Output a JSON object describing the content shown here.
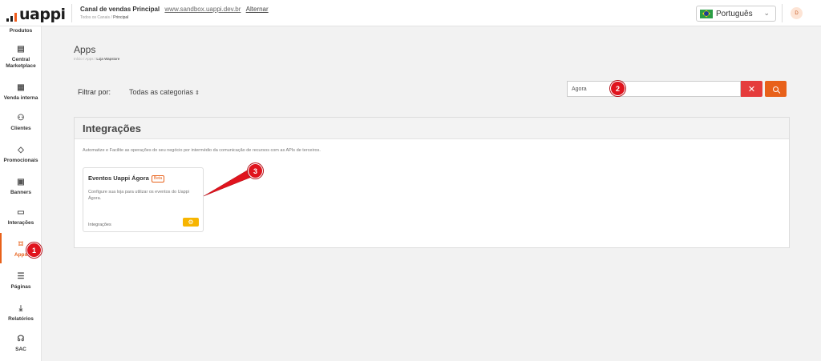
{
  "header": {
    "logo_text": "uappi",
    "channel_title": "Canal de vendas Principal",
    "channel_url": "www.sandbox.uappi.dev.br",
    "channel_switch": "Alternar",
    "crumbs": [
      "Todos os Canais",
      "Principal"
    ],
    "language": "Português",
    "avatar_initial": "D"
  },
  "sidebar": {
    "items": [
      {
        "label": "Produtos",
        "icon": "box-icon"
      },
      {
        "label": "Central Marketplace",
        "icon": "store-icon"
      },
      {
        "label": "Venda interna",
        "icon": "register-icon"
      },
      {
        "label": "Clientes",
        "icon": "users-icon"
      },
      {
        "label": "Promocionais",
        "icon": "tag-icon"
      },
      {
        "label": "Banners",
        "icon": "image-icon"
      },
      {
        "label": "Interações",
        "icon": "chat-icon"
      },
      {
        "label": "Apps",
        "icon": "puzzle-icon",
        "active": true
      },
      {
        "label": "Páginas",
        "icon": "page-icon"
      },
      {
        "label": "Relatórios",
        "icon": "download-icon"
      },
      {
        "label": "SAC",
        "icon": "headset-icon"
      }
    ]
  },
  "page": {
    "title": "Apps",
    "crumbs": [
      "Início",
      "Apps",
      "Loja Wapstore"
    ]
  },
  "filter": {
    "label": "Filtrar por:",
    "category": "Todas as categorias"
  },
  "search": {
    "value": "Ágora",
    "placeholder": ""
  },
  "panel": {
    "title": "Integrações",
    "description": "Automatize e Facilite as operações do seu negócio por intermédio da comunicação de recursos com as APIs de terceiros."
  },
  "card": {
    "title": "Eventos Uappi Ágora",
    "badge": "Beta",
    "description": "Configure sua loja para utilizar os eventos do Uappi Ágora.",
    "category": "Integrações"
  },
  "markers": [
    "1",
    "2",
    "3"
  ],
  "colors": {
    "accent": "#e8611a",
    "danger": "#e53c3c",
    "gear": "#f7b500",
    "marker": "#e0141e"
  }
}
